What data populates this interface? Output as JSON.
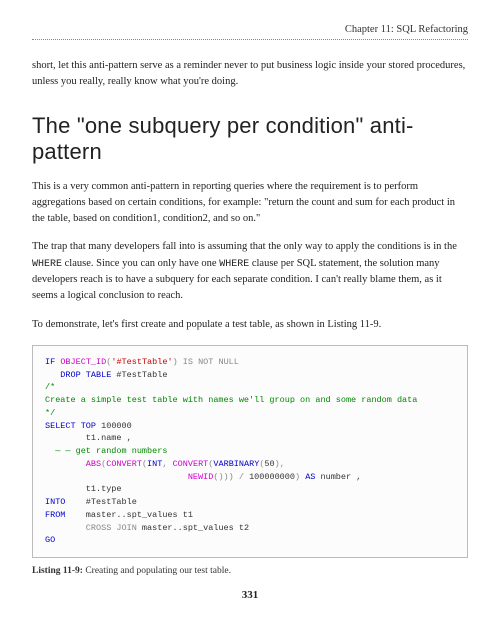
{
  "header": {
    "chapter": "Chapter 11: SQL Refactoring"
  },
  "intro": {
    "text": "short, let this anti-pattern serve as a reminder never to put business logic inside your stored procedures, unless you really, really know what you're doing."
  },
  "section": {
    "title": "The \"one subquery per condition\" anti-pattern"
  },
  "paragraphs": {
    "p1a": "This is a very common anti-pattern in reporting queries where the requirement is to perform aggregations based on certain conditions, for example: \"return the count and sum for each product in the table, based on condition1, condition2, and so on.\"",
    "p2a": "The trap that many developers fall into is assuming that the only way to apply the conditions is in the ",
    "p2b": " clause. Since you can only have one ",
    "p2c": " clause per SQL statement, the solution many developers reach is to have a subquery for each separate condition. I can't really blame them, as it seems a logical conclusion to reach.",
    "p3": "To demonstrate, let's first create and populate a test table, as shown in Listing 11-9.",
    "where1": "WHERE",
    "where2": "WHERE"
  },
  "code": {
    "IF": "IF",
    "OBJECT_ID": "OBJECT_ID",
    "lparen1": "(",
    "str1": "'#TestTable'",
    "rparen1": ")",
    "ISNOTNULL": " IS NOT NULL",
    "DROPTABLE": "   DROP TABLE",
    "tt1": " #TestTable",
    "comment_open": "/*",
    "comment_body": "Create a simple test table with names we'll group on and some random data",
    "comment_close": "*/",
    "SELECT": "SELECT",
    "TOP": " TOP",
    "num100000": " 100000",
    "t1name": "        t1.name ,",
    "dashcomment": "  — — get random numbers",
    "ABS": "        ABS",
    "lparen2": "(",
    "CONVERT1": "CONVERT",
    "lparen3": "(",
    "INT": "INT",
    "comma1": ", ",
    "CONVERT2": "CONVERT",
    "lparen4": "(",
    "VARBINARY": "VARBINARY",
    "lparen5": "(",
    "fifty": "50",
    "rparen5": ")",
    "comma2": ",",
    "spaces_newid": "                            ",
    "NEWID": "NEWID",
    "parens_empty": "()))",
    "slash": " / ",
    "hundredmil": "100000000",
    "rparen_end": ")",
    "AS": " AS",
    "number_lbl": " number ,",
    "t1type": "        t1.type",
    "INTO": "INTO",
    "tt2": "    #TestTable",
    "FROM": "FROM",
    "master1": "    master..spt_values t1",
    "CROSSJOIN": "        CROSS JOIN",
    "master2": " master..spt_values t2",
    "GO": "GO"
  },
  "caption": {
    "label": "Listing 11-9:",
    "text": "  Creating and populating our test table."
  },
  "page": {
    "number": "331"
  }
}
